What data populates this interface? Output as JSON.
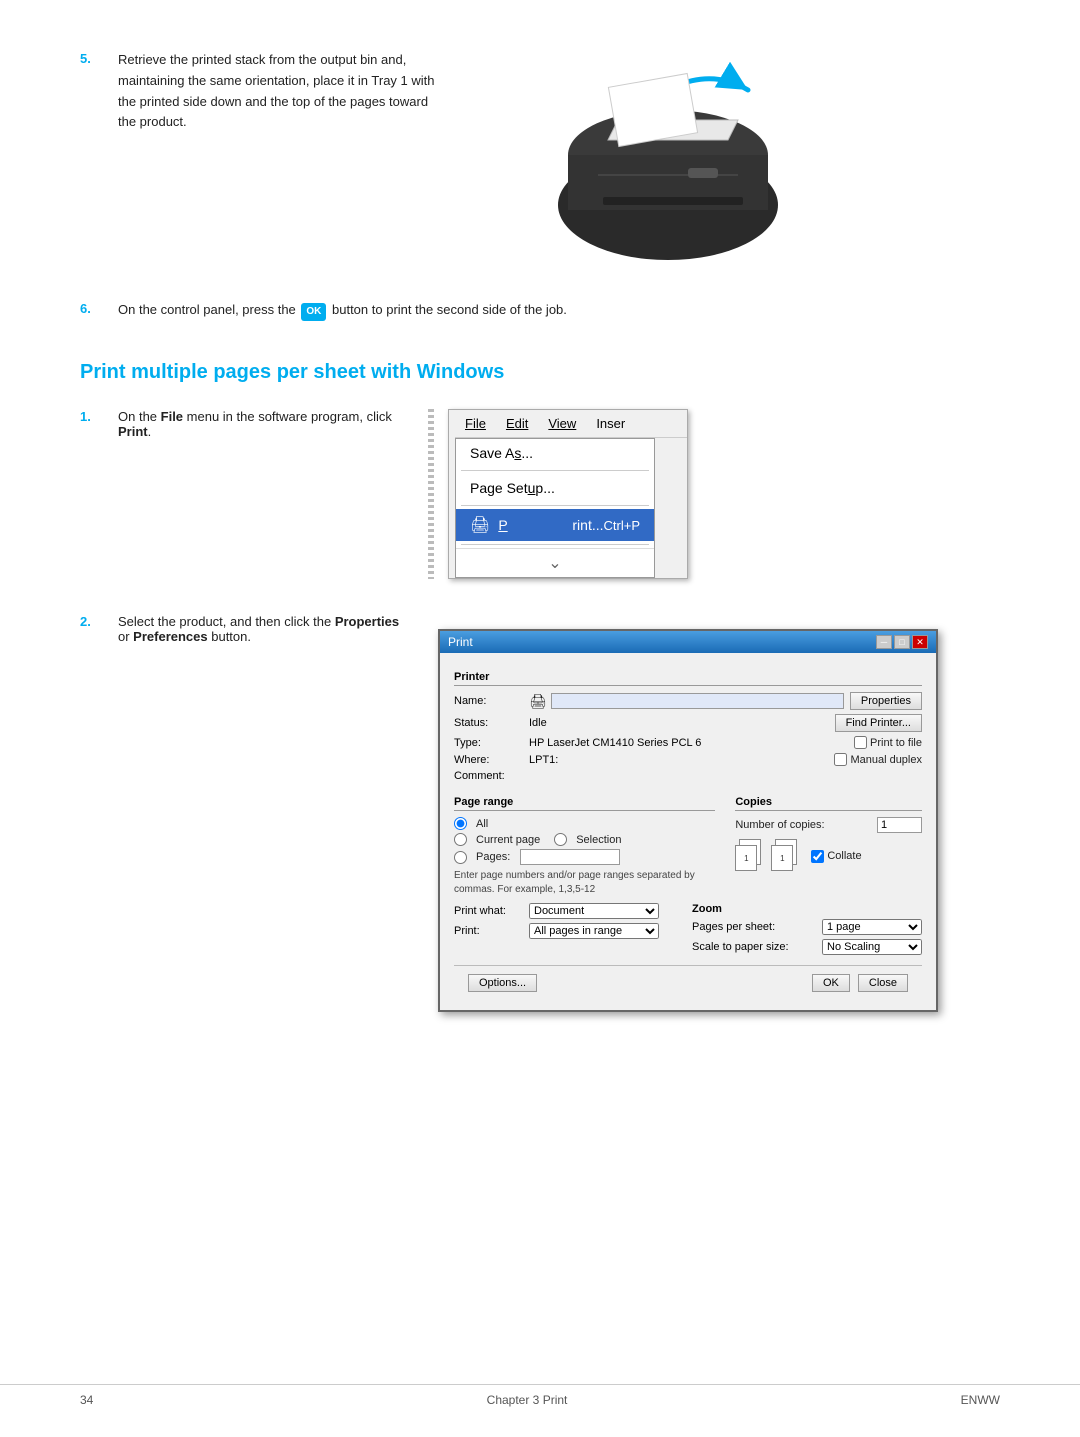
{
  "page": {
    "background": "#ffffff"
  },
  "step5": {
    "number": "5.",
    "text_parts": [
      "Retrieve the printed stack from the output bin and, maintaining the same orientation, place it in Tray 1 with the printed side down and the top of the pages toward the product."
    ]
  },
  "step6": {
    "number": "6.",
    "text_before": "On the control panel, press the ",
    "ok_label": "OK",
    "text_after": " button to print the second side of the job."
  },
  "section": {
    "heading": "Print multiple pages per sheet with Windows"
  },
  "step1": {
    "number": "1.",
    "text_before": "On the ",
    "bold1": "File",
    "text_middle": " menu in the software program, click ",
    "bold2": "Print",
    "text_end": "."
  },
  "step2": {
    "number": "2.",
    "text_before": "Select the product, and then click the ",
    "bold1": "Properties",
    "text_middle": " or ",
    "bold2": "Preferences",
    "text_end": " button."
  },
  "file_menu": {
    "bar_items": [
      "File",
      "Edit",
      "View",
      "Inser"
    ],
    "items": [
      {
        "label": "Save As...",
        "shortcut": "",
        "highlighted": false,
        "icon": false
      },
      {
        "label": "Page Setup...",
        "shortcut": "",
        "highlighted": false,
        "icon": false
      },
      {
        "label": "Print...",
        "shortcut": "Ctrl+P",
        "highlighted": true,
        "icon": true
      }
    ]
  },
  "print_dialog": {
    "title": "Print",
    "sections": {
      "printer": "Printer",
      "page_range": "Page range",
      "copies": "Copies",
      "zoom": "Zoom"
    },
    "printer": {
      "name_label": "Name:",
      "status_label": "Status:",
      "status_value": "Idle",
      "type_label": "Type:",
      "type_value": "HP LaserJet CM1410 Series PCL 6",
      "where_label": "Where:",
      "where_value": "LPT1:",
      "comment_label": "Comment:",
      "properties_btn": "Properties",
      "find_printer_btn": "Find Printer...",
      "print_to_file_label": "Print to file",
      "manual_duplex_label": "Manual duplex"
    },
    "page_range": {
      "all_label": "All",
      "current_page_label": "Current page",
      "selection_label": "Selection",
      "pages_label": "Pages:",
      "pages_hint": "Enter page numbers and/or page ranges separated by commas. For example, 1,3,5-12"
    },
    "print_what": {
      "label": "Print what:",
      "value": "Document"
    },
    "print": {
      "label": "Print:",
      "value": "All pages in range"
    },
    "copies": {
      "number_label": "Number of copies:",
      "number_value": "1",
      "collate_label": "Collate"
    },
    "zoom": {
      "pages_per_sheet_label": "Pages per sheet:",
      "pages_per_sheet_value": "1 page",
      "scale_label": "Scale to paper size:",
      "scale_value": "No Scaling"
    },
    "buttons": {
      "options": "Options...",
      "ok": "OK",
      "close": "Close"
    }
  },
  "footer": {
    "page_number": "34",
    "chapter_text": "Chapter 3   Print",
    "brand": "ENWW"
  }
}
